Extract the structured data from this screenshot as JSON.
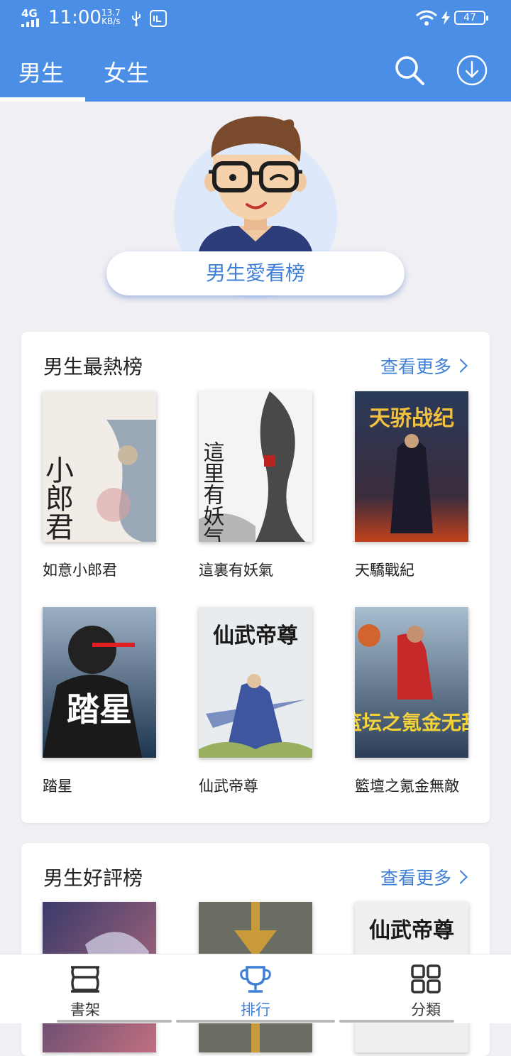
{
  "status_bar": {
    "network": "4G",
    "time": "11:00",
    "speed_value": "13.7",
    "speed_unit": "KB/s",
    "battery": "47"
  },
  "header": {
    "tabs": [
      {
        "label": "男生",
        "active": true
      },
      {
        "label": "女生",
        "active": false
      }
    ],
    "icons": [
      "search-icon",
      "download-icon"
    ]
  },
  "hero": {
    "button_label": "男生愛看榜"
  },
  "sections": [
    {
      "title": "男生最熱榜",
      "more_label": "查看更多",
      "books": [
        {
          "title": "如意小郎君",
          "cover_text": "小郎君",
          "cover_bg": "#f2ece6",
          "cover_fg": "#222222"
        },
        {
          "title": "這裏有妖氣",
          "cover_text": "這里有妖气",
          "cover_bg": "#f4f4f4",
          "cover_fg": "#1e1e1e"
        },
        {
          "title": "天驕戰紀",
          "cover_text": "天骄战纪",
          "cover_bg": "#2a3a5a",
          "cover_fg": "#f0c040"
        },
        {
          "title": "踏星",
          "cover_text": "踏星",
          "cover_bg": "#2b4a66",
          "cover_fg": "#ffffff"
        },
        {
          "title": "仙武帝尊",
          "cover_text": "仙武帝尊",
          "cover_bg": "#e8ecee",
          "cover_fg": "#1a1a1a"
        },
        {
          "title": "籃壇之氪金無敵",
          "cover_text": "篮坛之氪金无敌",
          "cover_bg": "#3c5870",
          "cover_fg": "#f3d23a"
        }
      ]
    },
    {
      "title": "男生好評榜",
      "more_label": "查看更多",
      "books": [
        {
          "cover_bg": "#5a4a78"
        },
        {
          "cover_bg": "#6a6e62"
        },
        {
          "cover_text": "仙武帝尊",
          "cover_bg": "#eef0f0",
          "cover_fg": "#1a1a1a"
        }
      ]
    }
  ],
  "bottom_nav": [
    {
      "label": "書架",
      "icon": "bookshelf-icon",
      "active": false
    },
    {
      "label": "排行",
      "icon": "trophy-icon",
      "active": true
    },
    {
      "label": "分類",
      "icon": "category-grid-icon",
      "active": false
    }
  ],
  "colors": {
    "primary": "#4a8ee6",
    "accent_text": "#3f7fd6",
    "background": "#efeff4"
  }
}
